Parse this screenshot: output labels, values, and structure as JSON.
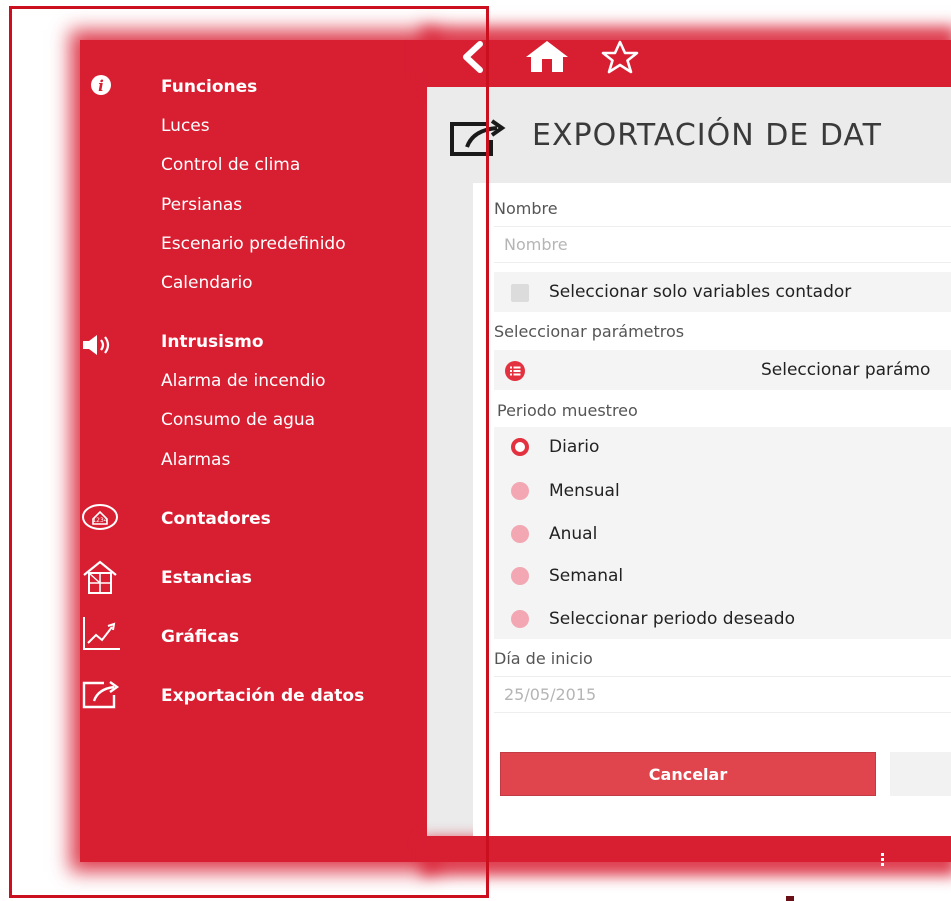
{
  "sidebar": {
    "items": [
      {
        "label": "Funciones",
        "icon": "info-icon"
      },
      {
        "label": "Luces"
      },
      {
        "label": "Control de clima"
      },
      {
        "label": "Persianas"
      },
      {
        "label": "Escenario predefinido"
      },
      {
        "label": "Calendario"
      },
      {
        "label": "Intrusismo",
        "icon": "speaker-icon"
      },
      {
        "label": "Alarma de incendio"
      },
      {
        "label": "Consumo de agua"
      },
      {
        "label": "Alarmas"
      },
      {
        "label": "Contadores",
        "icon": "meter-icon"
      },
      {
        "label": "Estancias",
        "icon": "rooms-icon"
      },
      {
        "label": "Gráficas",
        "icon": "chart-icon"
      },
      {
        "label": "Exportación de datos",
        "icon": "export-icon"
      }
    ]
  },
  "topbar": {
    "icons": [
      "back-icon",
      "home-icon",
      "star-icon"
    ]
  },
  "page": {
    "title": "EXPORTACIÓN DE DAT",
    "title_icon": "export-icon"
  },
  "form": {
    "nombre_label": "Nombre",
    "nombre_placeholder": "Nombre",
    "contador_checkbox_label": "Seleccionar solo variables contador",
    "parametros_label": "Seleccionar parámetros",
    "parametros_button": "Seleccionar parámo",
    "periodo_label": "Periodo muestreo",
    "periodo_options": [
      "Diario",
      "Mensual",
      "Anual",
      "Semanal",
      "Seleccionar periodo deseado"
    ],
    "periodo_selected": "Diario",
    "inicio_label": "Día de inicio",
    "inicio_value": "25/05/2015"
  },
  "buttons": {
    "cancel": "Cancelar"
  },
  "colors": {
    "accent": "#d81f32",
    "radio_off": "#f2a7b2",
    "cancel": "#e0454e"
  }
}
